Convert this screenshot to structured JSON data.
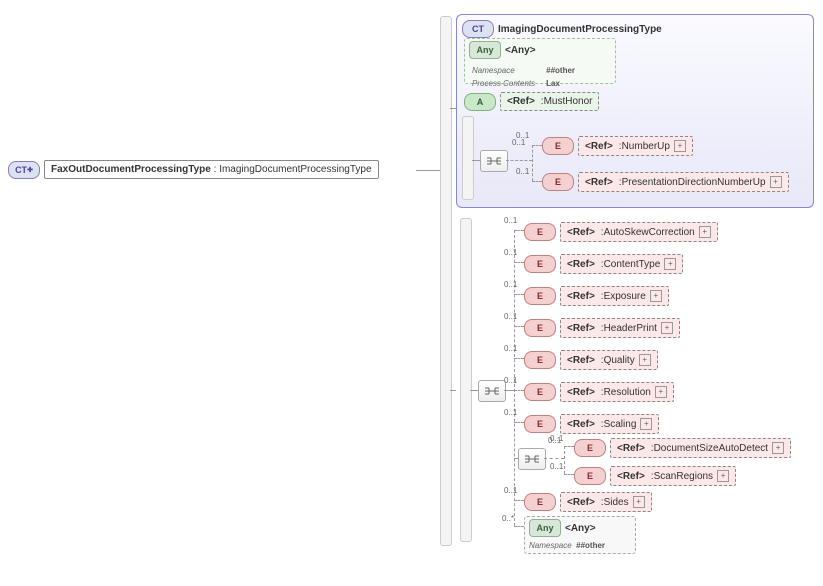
{
  "root": {
    "badge": "CT",
    "name": "FaxOutDocumentProcessingType",
    "base": "ImagingDocumentProcessingType"
  },
  "superType": {
    "badge": "CT",
    "title": "ImagingDocumentProcessingType",
    "any": {
      "badge": "Any",
      "tag": "<Any>",
      "ns_label": "Namespace",
      "ns_val": "##other",
      "pc_label": "Process Contents",
      "pc_val": "Lax"
    },
    "attr": {
      "badge": "A",
      "tag": "<Ref>",
      "name": "MustHonor"
    },
    "seq": {
      "card": "0..1",
      "items": [
        {
          "badge": "E",
          "tag": "<Ref>",
          "name": "NumberUp",
          "card": "0..1"
        },
        {
          "badge": "E",
          "tag": "<Ref>",
          "name": "PresentationDirectionNumberUp",
          "card": "0..1"
        }
      ]
    }
  },
  "extSeq": {
    "items": [
      {
        "badge": "E",
        "tag": "<Ref>",
        "name": "AutoSkewCorrection",
        "card": "0..1"
      },
      {
        "badge": "E",
        "tag": "<Ref>",
        "name": "ContentType",
        "card": "0..1"
      },
      {
        "badge": "E",
        "tag": "<Ref>",
        "name": "Exposure",
        "card": "0..1"
      },
      {
        "badge": "E",
        "tag": "<Ref>",
        "name": "HeaderPrint",
        "card": "0..1"
      },
      {
        "badge": "E",
        "tag": "<Ref>",
        "name": "Quality",
        "card": "0..1"
      },
      {
        "badge": "E",
        "tag": "<Ref>",
        "name": "Resolution",
        "card": "0..1"
      },
      {
        "badge": "E",
        "tag": "<Ref>",
        "name": "Scaling",
        "card": "0..1"
      }
    ],
    "subSeq": {
      "card": "0..1",
      "items": [
        {
          "badge": "E",
          "tag": "<Ref>",
          "name": "DocumentSizeAutoDetect",
          "card": "0..1"
        },
        {
          "badge": "E",
          "tag": "<Ref>",
          "name": "ScanRegions",
          "card": "0..1"
        }
      ]
    },
    "tail": [
      {
        "badge": "E",
        "tag": "<Ref>",
        "name": "Sides",
        "card": "0..1"
      }
    ],
    "any": {
      "badge": "Any",
      "tag": "<Any>",
      "card": "0..*",
      "ns_label": "Namespace",
      "ns_val": "##other"
    }
  }
}
